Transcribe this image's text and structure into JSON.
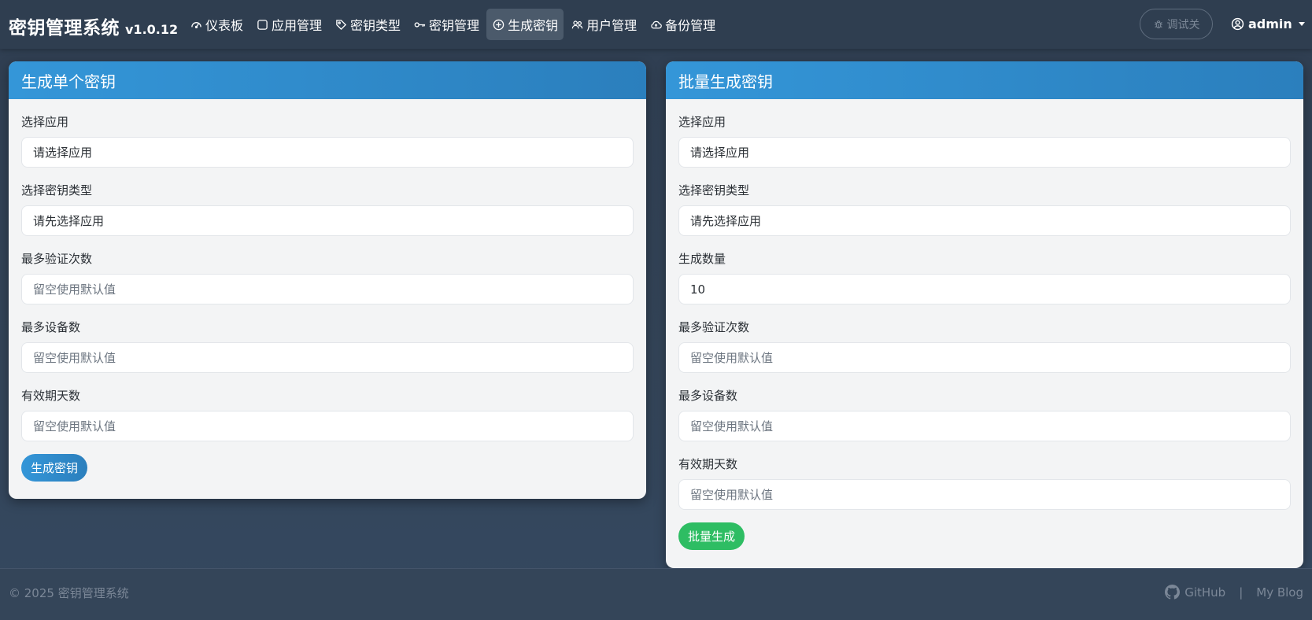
{
  "brand": {
    "title": "密钥管理系统",
    "version": "v1.0.12"
  },
  "nav": {
    "items": [
      {
        "label": "仪表板",
        "icon": "speedometer-icon"
      },
      {
        "label": "应用管理",
        "icon": "square-icon"
      },
      {
        "label": "密钥类型",
        "icon": "tag-icon"
      },
      {
        "label": "密钥管理",
        "icon": "key-icon"
      },
      {
        "label": "生成密钥",
        "icon": "plus-circle-icon",
        "active": true
      },
      {
        "label": "用户管理",
        "icon": "people-icon"
      },
      {
        "label": "备份管理",
        "icon": "cloud-upload-icon"
      }
    ],
    "debug_label": "调试关",
    "user_label": "admin"
  },
  "single": {
    "title": "生成单个密钥",
    "app_label": "选择应用",
    "app_value": "请选择应用",
    "type_label": "选择密钥类型",
    "type_value": "请先选择应用",
    "max_verify_label": "最多验证次数",
    "max_verify_placeholder": "留空使用默认值",
    "max_devices_label": "最多设备数",
    "max_devices_placeholder": "留空使用默认值",
    "valid_days_label": "有效期天数",
    "valid_days_placeholder": "留空使用默认值",
    "submit_label": "生成密钥"
  },
  "batch": {
    "title": "批量生成密钥",
    "app_label": "选择应用",
    "app_value": "请选择应用",
    "type_label": "选择密钥类型",
    "type_value": "请先选择应用",
    "count_label": "生成数量",
    "count_value": "10",
    "max_verify_label": "最多验证次数",
    "max_verify_placeholder": "留空使用默认值",
    "max_devices_label": "最多设备数",
    "max_devices_placeholder": "留空使用默认值",
    "valid_days_label": "有效期天数",
    "valid_days_placeholder": "留空使用默认值",
    "submit_label": "批量生成"
  },
  "footer": {
    "copyright": "© 2025 密钥管理系统",
    "github_label": "GitHub",
    "separator": "|",
    "blog_label": "My Blog"
  },
  "colors": {
    "header_blue": "#3496d8",
    "success_green": "#2ebd63",
    "navbar_bg": "#2f3e50"
  }
}
